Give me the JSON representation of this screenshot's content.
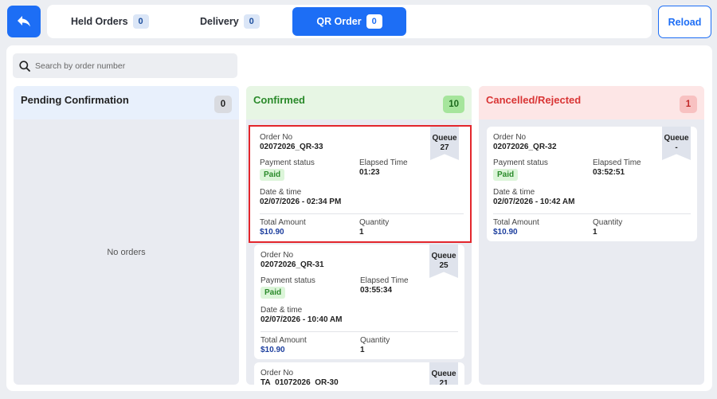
{
  "topbar": {
    "tabs": [
      {
        "label": "Held Orders",
        "count": "0"
      },
      {
        "label": "Delivery",
        "count": "0"
      },
      {
        "label": "QR Order",
        "count": "0"
      }
    ],
    "reload_label": "Reload"
  },
  "search": {
    "placeholder": "Search by order number"
  },
  "columns": {
    "pending": {
      "title": "Pending Confirmation",
      "count": "0",
      "empty_text": "No orders"
    },
    "confirmed": {
      "title": "Confirmed",
      "count": "10"
    },
    "cancelled": {
      "title": "Cancelled/Rejected",
      "count": "1"
    }
  },
  "labels": {
    "order_no": "Order No",
    "queue": "Queue",
    "payment_status": "Payment status",
    "elapsed_time": "Elapsed Time",
    "date_time": "Date & time",
    "total_amount": "Total Amount",
    "quantity": "Quantity"
  },
  "confirmed_orders": [
    {
      "order_no": "02072026_QR-33",
      "queue": "27",
      "payment": "Paid",
      "elapsed": "01:23",
      "datetime": "02/07/2026 - 02:34 PM",
      "amount": "$10.90",
      "quantity": "1"
    },
    {
      "order_no": "02072026_QR-31",
      "queue": "25",
      "payment": "Paid",
      "elapsed": "03:55:34",
      "datetime": "02/07/2026 - 10:40 AM",
      "amount": "$10.90",
      "quantity": "1"
    },
    {
      "order_no": "TA_01072026_QR-30",
      "queue": "21"
    }
  ],
  "cancelled_orders": [
    {
      "order_no": "02072026_QR-32",
      "queue": "-",
      "payment": "Paid",
      "elapsed": "03:52:51",
      "datetime": "02/07/2026 - 10:42 AM",
      "amount": "$10.90",
      "quantity": "1"
    }
  ],
  "colors": {
    "primary": "#1d6ef5",
    "confirmed": "#2a8a2a",
    "cancelled": "#d93535",
    "selection": "#e3262c"
  }
}
